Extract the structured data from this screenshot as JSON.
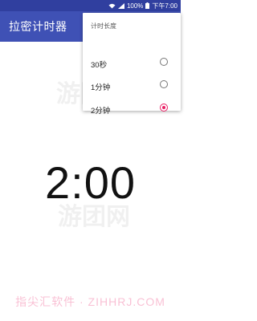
{
  "status_bar": {
    "battery": "100%",
    "time": "下午7:00",
    "wifi_icon": "wifi-icon",
    "signal_icon": "signal-icon",
    "battery_icon": "battery-icon"
  },
  "app": {
    "title": "拉密计时器"
  },
  "menu": {
    "title": "计时长度",
    "items": [
      {
        "label": "30秒",
        "selected": false
      },
      {
        "label": "1分钟",
        "selected": false
      },
      {
        "label": "2分钟",
        "selected": true
      }
    ]
  },
  "timer": {
    "display": "2:00"
  },
  "watermark": {
    "logo_text": "游团网",
    "bottom_text": "指尖汇软件 · ZIHHRJ.COM"
  },
  "colors": {
    "status_bar": "#303f9f",
    "app_bar": "#3f51b5",
    "accent": "#e91e63"
  }
}
